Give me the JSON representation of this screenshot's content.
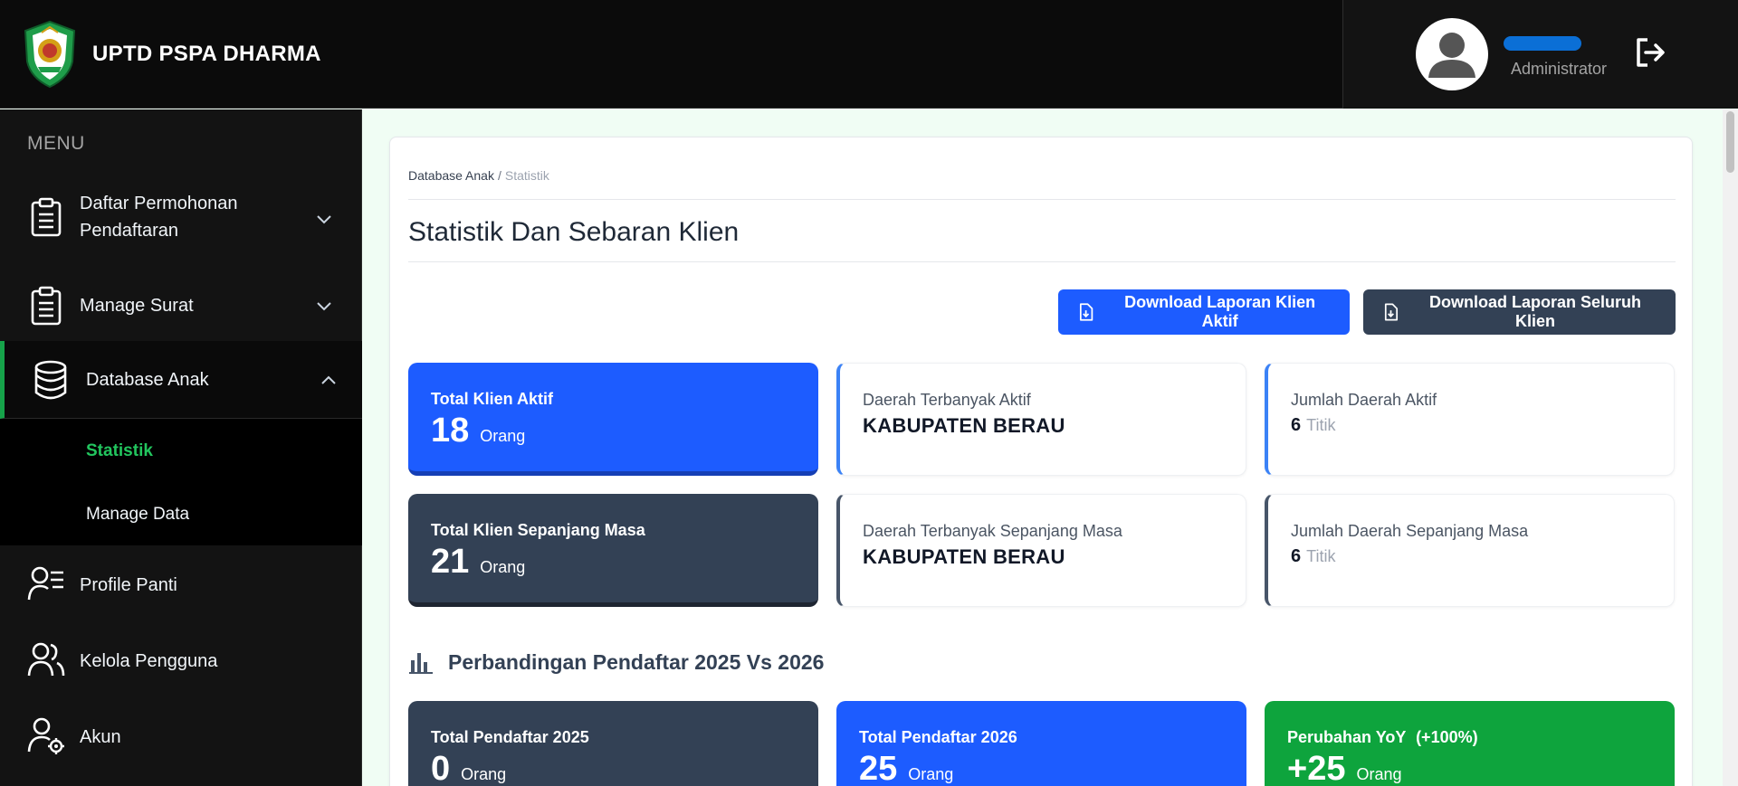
{
  "app": {
    "name": "UPTD PSPA DHARMA"
  },
  "user": {
    "role": "Administrator"
  },
  "sidebar": {
    "menu_label": "MENU",
    "items": [
      {
        "label": "Daftar Permohonan Pendaftaran",
        "icon": "clipboard-icon"
      },
      {
        "label": "Manage Surat",
        "icon": "clipboard-icon"
      },
      {
        "label": "Database Anak",
        "icon": "database-icon"
      },
      {
        "label": "Profile Panti",
        "icon": "user-list-icon"
      },
      {
        "label": "Kelola Pengguna",
        "icon": "users-icon"
      },
      {
        "label": "Akun",
        "icon": "user-gear-icon"
      }
    ],
    "submenu": [
      {
        "label": "Statistik"
      },
      {
        "label": "Manage Data"
      }
    ]
  },
  "breadcrumb": {
    "parent": "Database Anak",
    "separator": "/",
    "current": "Statistik"
  },
  "page": {
    "title": "Statistik Dan Sebaran Klien"
  },
  "buttons": {
    "download_active": "Download Laporan Klien Aktif",
    "download_all": "Download Laporan Seluruh Klien"
  },
  "stats": {
    "total_aktif": {
      "title": "Total Klien Aktif",
      "value": "18",
      "unit": "Orang"
    },
    "daerah_aktif": {
      "title": "Daerah Terbanyak Aktif",
      "value": "KABUPATEN BERAU"
    },
    "jumlah_daerah_aktif": {
      "title": "Jumlah Daerah Aktif",
      "value": "6",
      "unit": "Titik"
    },
    "total_sepanjang": {
      "title": "Total Klien Sepanjang Masa",
      "value": "21",
      "unit": "Orang"
    },
    "daerah_sepanjang": {
      "title": "Daerah Terbanyak Sepanjang Masa",
      "value": "KABUPATEN BERAU"
    },
    "jumlah_daerah_sepanjang": {
      "title": "Jumlah Daerah Sepanjang Masa",
      "value": "6",
      "unit": "Titik"
    }
  },
  "comparison": {
    "title": "Perbandingan Pendaftar 2025 Vs 2026",
    "cards": [
      {
        "title": "Total Pendaftar 2025",
        "value": "0",
        "unit": "Orang"
      },
      {
        "title": "Total Pendaftar 2026",
        "value": "25",
        "unit": "Orang"
      },
      {
        "title": "Perubahan YoY",
        "badge": "(+100%)",
        "value": "+25",
        "unit": "Orang"
      }
    ]
  },
  "colors": {
    "primary": "#1d5cff",
    "dark": "#334155",
    "success": "#0ea43d",
    "accent_green": "#22c55e"
  }
}
